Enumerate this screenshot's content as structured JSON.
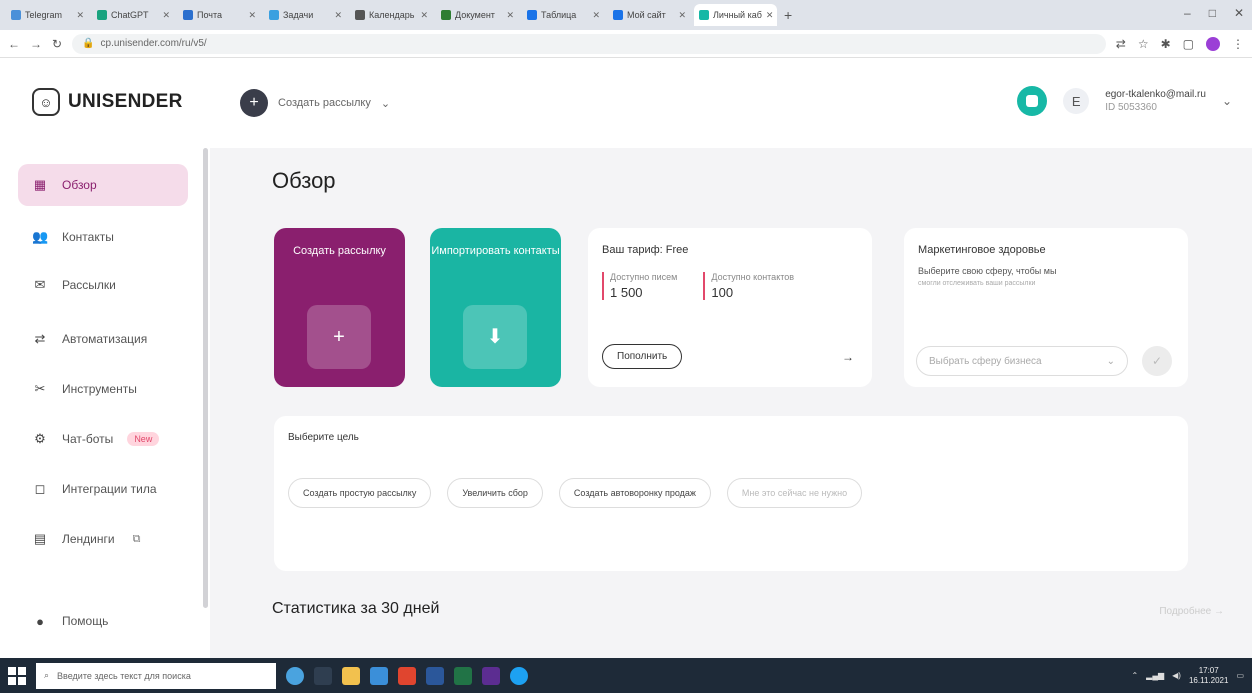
{
  "browser": {
    "tabs": [
      {
        "label": "Telegram",
        "color": "#4a90d9"
      },
      {
        "label": "ChatGPT",
        "color": "#19a37f"
      },
      {
        "label": "Почта",
        "color": "#2b6fce"
      },
      {
        "label": "Задачи",
        "color": "#3aa0e0"
      },
      {
        "label": "Календарь",
        "color": "#555"
      },
      {
        "label": "Документ",
        "color": "#2e7d32"
      },
      {
        "label": "Таблица",
        "color": "#1a73e8"
      },
      {
        "label": "Мой сайт",
        "color": "#1a73e8"
      },
      {
        "label": "Личный каб",
        "color": "#17b8a6"
      }
    ],
    "new_tab": "+",
    "url": "cp.unisender.com/ru/v5/",
    "window_controls": [
      "–",
      "□",
      "✕"
    ]
  },
  "header": {
    "logo_text": "UNISENDER",
    "create_label": "Создать рассылку",
    "avatar_letter": "E",
    "user_email": "egor-tkalenko@mail.ru",
    "user_id": "ID 5053360"
  },
  "sidebar": {
    "items": [
      {
        "label": "Обзор",
        "icon": "grid-icon",
        "glyph": "▦"
      },
      {
        "label": "Контакты",
        "icon": "contacts-icon",
        "glyph": "👥"
      },
      {
        "label": "Рассылки",
        "icon": "mail-icon",
        "glyph": "✉"
      },
      {
        "label": "Автоматизация",
        "icon": "automation-icon",
        "glyph": "⇄"
      },
      {
        "label": "Инструменты",
        "icon": "tools-icon",
        "glyph": "✂"
      },
      {
        "label": "Чат-боты",
        "icon": "bot-icon",
        "glyph": "⚙",
        "badge": "New"
      },
      {
        "label": "Интеграции тила",
        "icon": "integration-icon",
        "glyph": "◻"
      },
      {
        "label": "Лендинги",
        "icon": "landing-icon",
        "glyph": "▤"
      },
      {
        "label": "Помощь",
        "icon": "help-icon",
        "glyph": "●"
      }
    ]
  },
  "main": {
    "title": "Обзор",
    "tiles": [
      {
        "label": "Создать рассылку",
        "glyph": "+"
      },
      {
        "label": "Импортировать контакты",
        "glyph": "⬇"
      }
    ],
    "tariff": {
      "title": "Ваш тариф: Free",
      "emails_label": "Доступно писем",
      "emails_value": "1 500",
      "contacts_label": "Доступно контактов",
      "contacts_value": "100",
      "upgrade_label": "Пополнить",
      "arrow": "→"
    },
    "health": {
      "title": "Маркетинговое здоровье",
      "subtitle": "Выберите свою сферу, чтобы мы",
      "desc": "смогли отслеживать ваши рассылки",
      "select_placeholder": "Выбрать сферу бизнеса",
      "ok_glyph": "✓"
    },
    "goal": {
      "title": "Выберите цель",
      "chips": [
        "Создать простую рассылку",
        "Увеличить сбор",
        "Создать автоворонку продаж",
        "Мне это сейчас не нужно"
      ]
    },
    "stats_title": "Статистика за 30 дней",
    "details_label": "Подробнее →"
  },
  "taskbar": {
    "search_placeholder": "Введите здесь текст для поиска",
    "time": "17:07",
    "date": "16.11.2021"
  }
}
